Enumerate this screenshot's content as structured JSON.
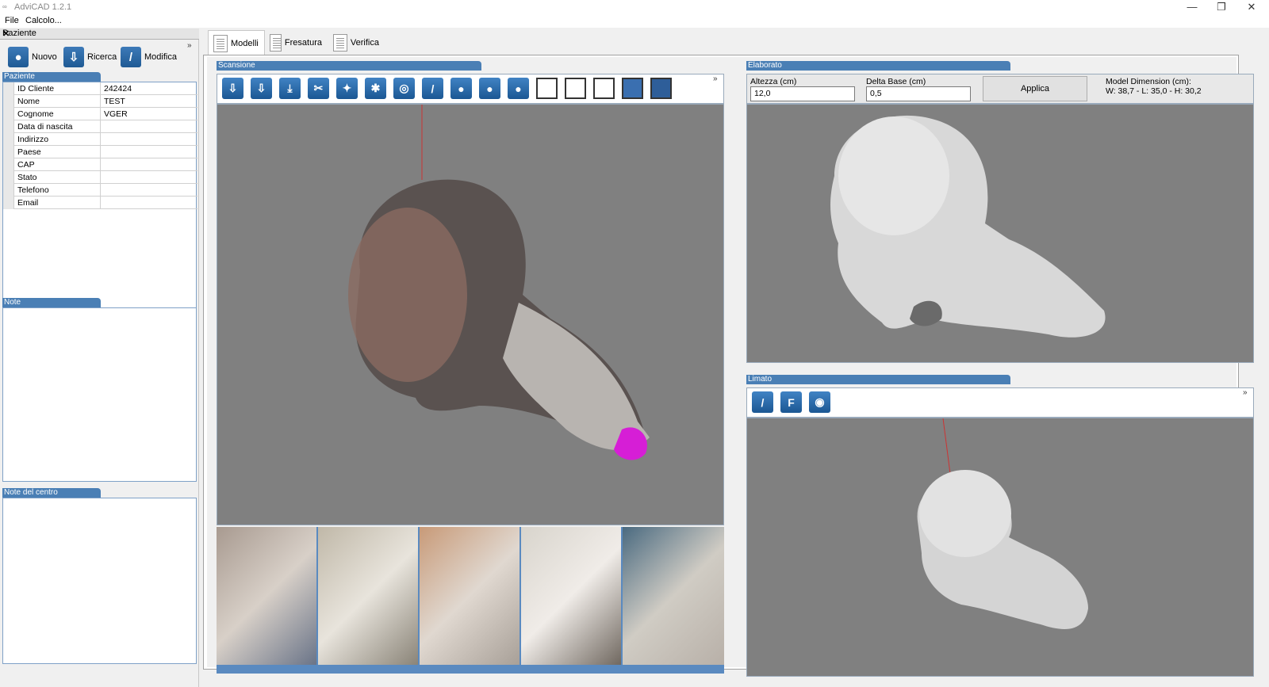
{
  "window": {
    "title": "AdviCAD 1.2.1",
    "minimize": "—",
    "restore": "❐",
    "close": "✕"
  },
  "menu": {
    "file": "File",
    "calc": "Calcolo..."
  },
  "left": {
    "panel_title": "Paziente",
    "close": "✕",
    "more": "»",
    "toolbar": {
      "new": "Nuovo",
      "search": "Ricerca",
      "edit": "Modifica"
    },
    "patient_section": "Paziente",
    "fields": [
      {
        "key": "ID Cliente",
        "value": "242424"
      },
      {
        "key": "Nome",
        "value": "TEST"
      },
      {
        "key": "Cognome",
        "value": "VGER"
      },
      {
        "key": "Data di nascita",
        "value": ""
      },
      {
        "key": "Indirizzo",
        "value": ""
      },
      {
        "key": "Paese",
        "value": ""
      },
      {
        "key": "CAP",
        "value": ""
      },
      {
        "key": "Stato",
        "value": ""
      },
      {
        "key": "Telefono",
        "value": ""
      },
      {
        "key": "Email",
        "value": ""
      }
    ],
    "notes_section": "Note",
    "center_notes_section": "Note del centro"
  },
  "tabs": {
    "models": "Modelli",
    "milling": "Fresatura",
    "verify": "Verifica"
  },
  "scan": {
    "section": "Scansione",
    "more": "»"
  },
  "processed": {
    "section": "Elaborato",
    "height_label": "Altezza (cm)",
    "height_value": "12,0",
    "delta_label": "Delta Base (cm)",
    "delta_value": "0,5",
    "apply": "Applica",
    "dim_label": "Model Dimension (cm):",
    "dim_value": "W: 38,7 - L: 35,0 - H: 30,2"
  },
  "filed": {
    "section": "Limato",
    "more": "»",
    "f_label": "F"
  }
}
